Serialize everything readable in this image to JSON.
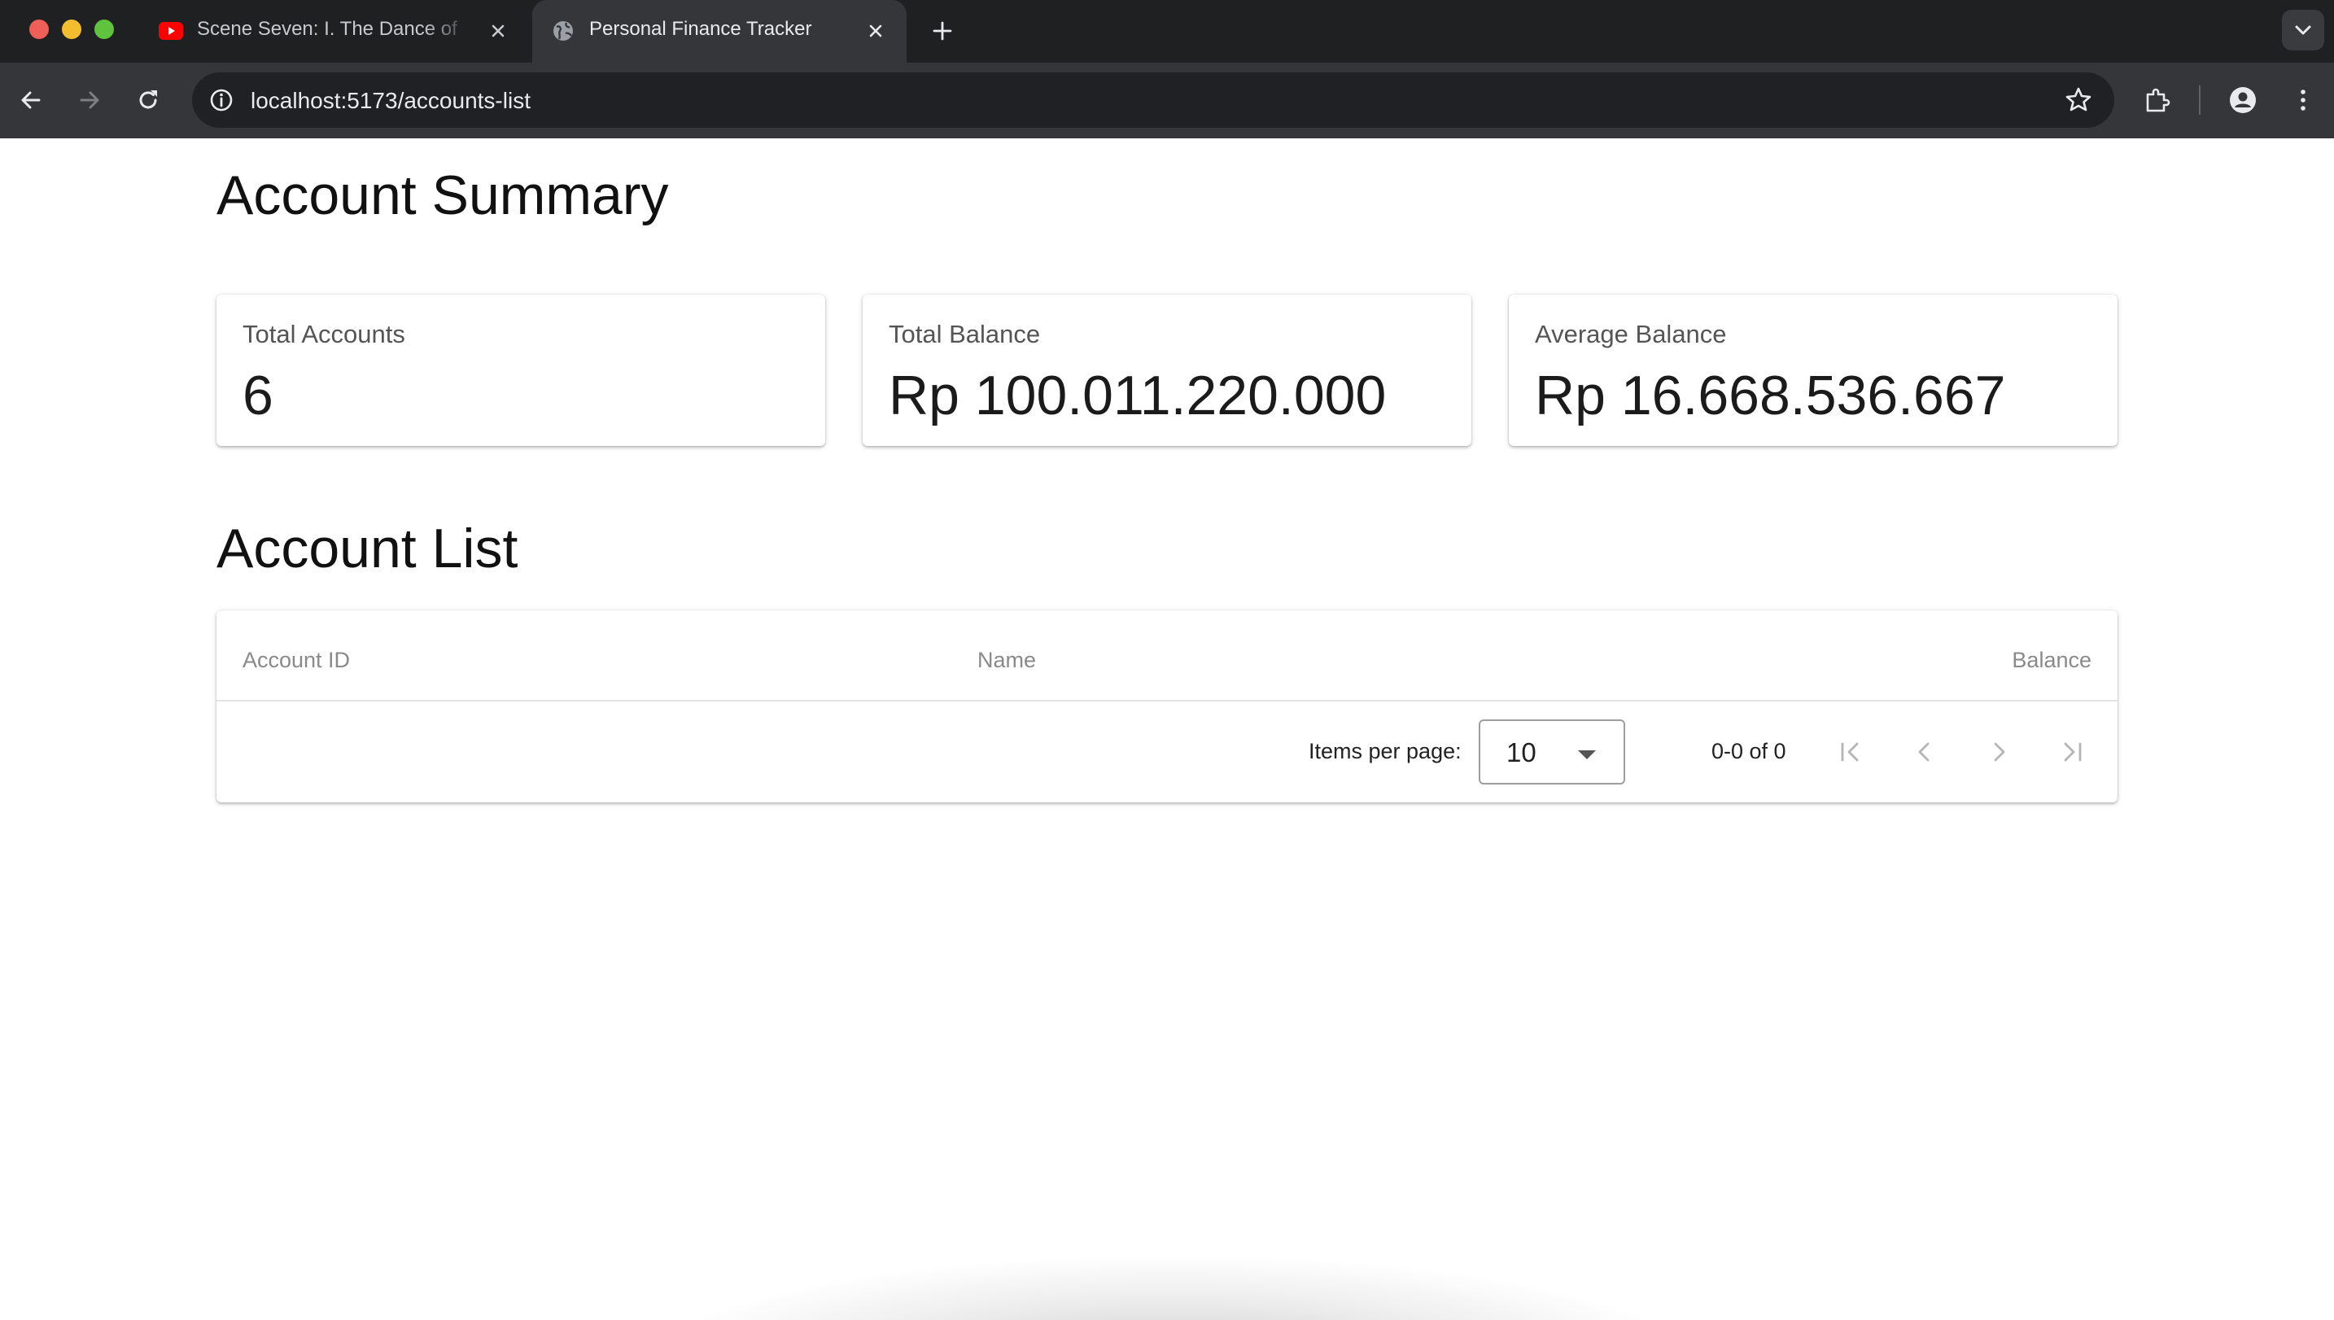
{
  "browser": {
    "tabs": [
      {
        "title": "Scene Seven: I. The Dance of",
        "favicon": "youtube-icon",
        "active": false
      },
      {
        "title": "Personal Finance Tracker",
        "favicon": "globe-icon",
        "active": true
      }
    ],
    "url": "localhost:5173/accounts-list"
  },
  "summary": {
    "title": "Account Summary",
    "cards": [
      {
        "label": "Total Accounts",
        "value": "6"
      },
      {
        "label": "Total Balance",
        "value": "Rp 100.011.220.000"
      },
      {
        "label": "Average Balance",
        "value": "Rp 16.668.536.667"
      }
    ]
  },
  "account_list": {
    "title": "Account List",
    "columns": [
      "Account ID",
      "Name",
      "Balance"
    ],
    "rows": [],
    "pagination": {
      "items_per_page_label": "Items per page:",
      "items_per_page": "10",
      "range": "0-0 of 0"
    }
  },
  "colors": {
    "tabbar": "#1f2022",
    "toolbar": "#35363a",
    "omnibox": "#202124",
    "youtube": "#ff0000"
  }
}
